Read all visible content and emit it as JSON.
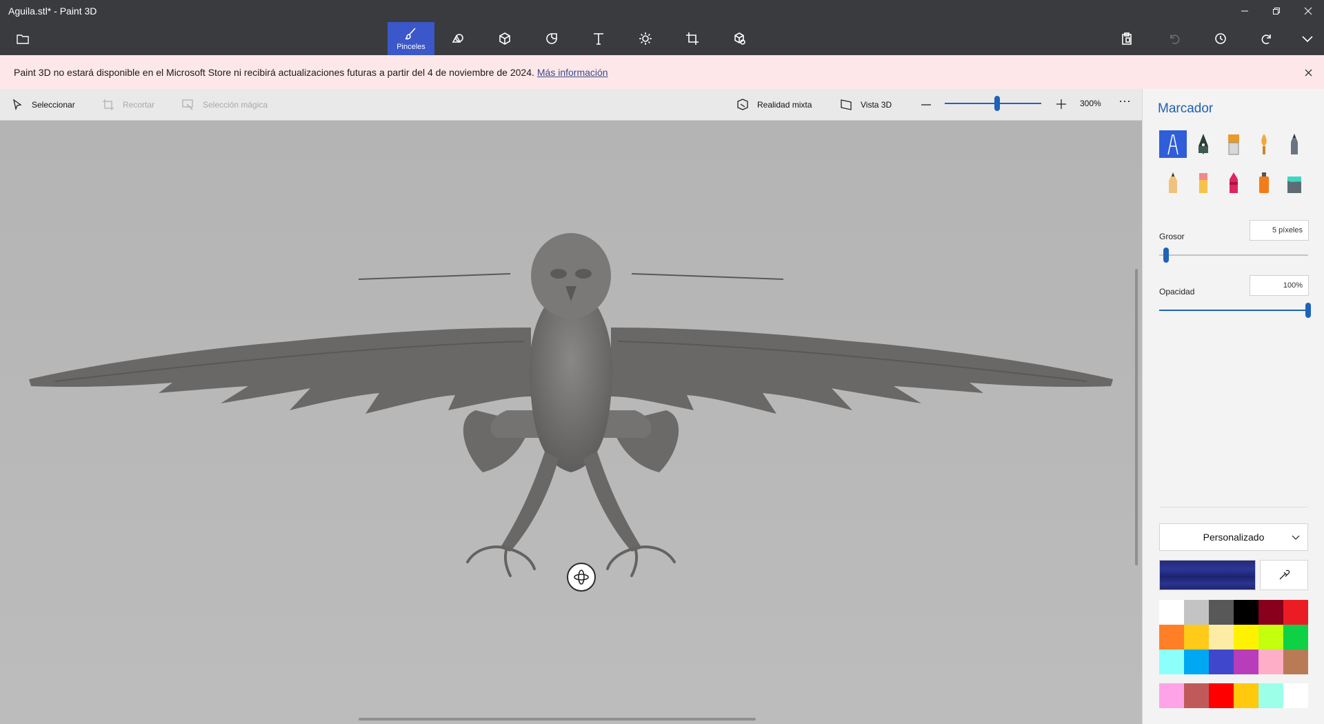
{
  "window": {
    "title": "Aguila.stl* - Paint 3D",
    "minimize_icon": "minimize-icon",
    "maximize_icon": "restore-icon",
    "close_icon": "close-icon"
  },
  "toolbar": {
    "folder_icon": "folder-icon",
    "tools": [
      {
        "name": "brushes",
        "label": "Pinceles",
        "icon": "brush-icon",
        "active": true
      },
      {
        "name": "2d-shapes",
        "label": "",
        "icon": "shapes-2d-icon",
        "active": false
      },
      {
        "name": "3d-shapes",
        "label": "",
        "icon": "cube-icon",
        "active": false
      },
      {
        "name": "stickers",
        "label": "",
        "icon": "sticker-icon",
        "active": false
      },
      {
        "name": "text",
        "label": "",
        "icon": "text-icon",
        "active": false
      },
      {
        "name": "effects",
        "label": "",
        "icon": "sun-icon",
        "active": false
      },
      {
        "name": "canvas",
        "label": "",
        "icon": "canvas-crop-icon",
        "active": false
      },
      {
        "name": "3d-library",
        "label": "",
        "icon": "library-3d-icon",
        "active": false
      }
    ],
    "right_tools": [
      "paste-icon",
      "undo-icon",
      "history-icon",
      "redo-icon",
      "chevron-down-icon"
    ]
  },
  "notice": {
    "text": "Paint 3D no estará disponible en el Microsoft Store ni recibirá actualizaciones futuras a partir del 4 de noviembre de 2024.",
    "link": "Más información"
  },
  "subbar": {
    "select": "Seleccionar",
    "crop": "Recortar",
    "magic_select": "Selección mágica",
    "mixed_reality": "Realidad mixta",
    "view3d": "Vista 3D",
    "zoom": "300%",
    "zoom_level": 0.6,
    "more": "···"
  },
  "panel": {
    "title": "Marcador",
    "brushes": [
      "marker",
      "calligraphy-pen",
      "oil-brush",
      "watercolor",
      "pencil-gray",
      "pencil",
      "eraser",
      "crayon",
      "spray-can",
      "fill-bucket"
    ],
    "thickness_label": "Grosor",
    "thickness_value": "5 píxeles",
    "thickness_level": 0.05,
    "opacity_label": "Opacidad",
    "opacity_value": "100%",
    "opacity_level": 1.0,
    "palette_label": "Personalizado",
    "current_color": "#262d80",
    "swatches": [
      "#ffffff",
      "#c3c3c3",
      "#585858",
      "#000000",
      "#88001b",
      "#ec1c24",
      "#ff7f27",
      "#ffca18",
      "#fdeca6",
      "#fff200",
      "#c4ff0e",
      "#0ed145",
      "#8cfffb",
      "#00a8f3",
      "#3f48cc",
      "#b83dba",
      "#ffaec8",
      "#b97a56"
    ],
    "custom_swatches": [
      "#ffa3e9",
      "#c05a5a",
      "#ff0000",
      "#ffc90e",
      "#9cffe8",
      "#ffffff"
    ]
  }
}
